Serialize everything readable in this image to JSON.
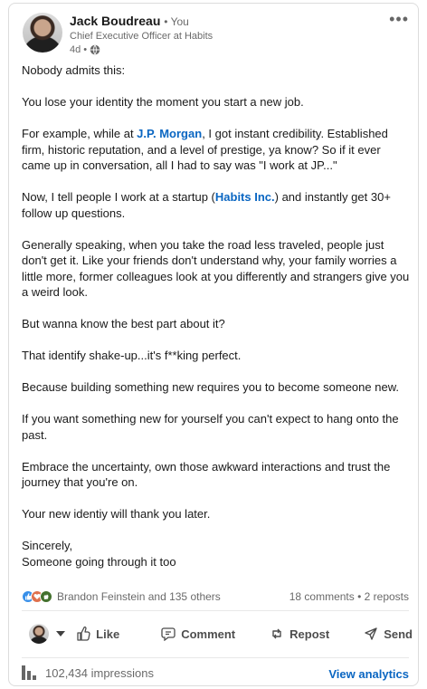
{
  "post": {
    "author": {
      "name": "Jack Boudreau",
      "badge": "• You",
      "headline": "Chief Executive Officer at Habits",
      "timestamp": "4d •",
      "visibility_icon": "globe-icon"
    },
    "more_label": "•••",
    "body": {
      "p1": "Nobody admits this:",
      "p2": "You lose your identity the moment you start a new job.",
      "p3_pre": "For example, while at ",
      "p3_link": "J.P. Morgan",
      "p3_post": ", I got instant credibility. Established firm, historic reputation, and a level of prestige, ya know? So if it ever came up in conversation, all I had to say was \"I work at JP...\"",
      "p4_pre": "Now, I tell people I work at a startup (",
      "p4_link": "Habits Inc.",
      "p4_post": ") and instantly get 30+ follow up questions.",
      "p5": "Generally speaking, when you take the road less traveled, people just don't get it. Like your friends don't understand why, your family worries a little more, former colleagues look at you differently and strangers give you a weird look.",
      "p6": "But wanna know the best part about it?",
      "p7": "That identify shake-up...it's f**king perfect.",
      "p8": "Because building something new requires you to become someone new.",
      "p9": "If you want something new for yourself you can't expect to hang onto the past.",
      "p10": "Embrace the uncertainty, own those awkward interactions and trust the journey that you're on.",
      "p11": "Your new identiy will thank you later.",
      "sign1": "Sincerely,",
      "sign2": "Someone going through it too"
    },
    "social": {
      "reactions": [
        "like-reaction-icon",
        "love-reaction-icon",
        "celebrate-reaction-icon"
      ],
      "reactors": "Brandon Feinstein and 135 others",
      "comments": "18 comments",
      "separator": " • ",
      "reposts": "2 reposts"
    },
    "actions": {
      "like": "Like",
      "comment": "Comment",
      "repost": "Repost",
      "send": "Send"
    },
    "footer": {
      "impressions": "102,434 impressions",
      "analytics": "View analytics"
    },
    "colors": {
      "link": "#0a66c2",
      "like_reaction": "#378fe9",
      "love_reaction": "#df704d",
      "celebrate_reaction": "#44712e"
    }
  }
}
